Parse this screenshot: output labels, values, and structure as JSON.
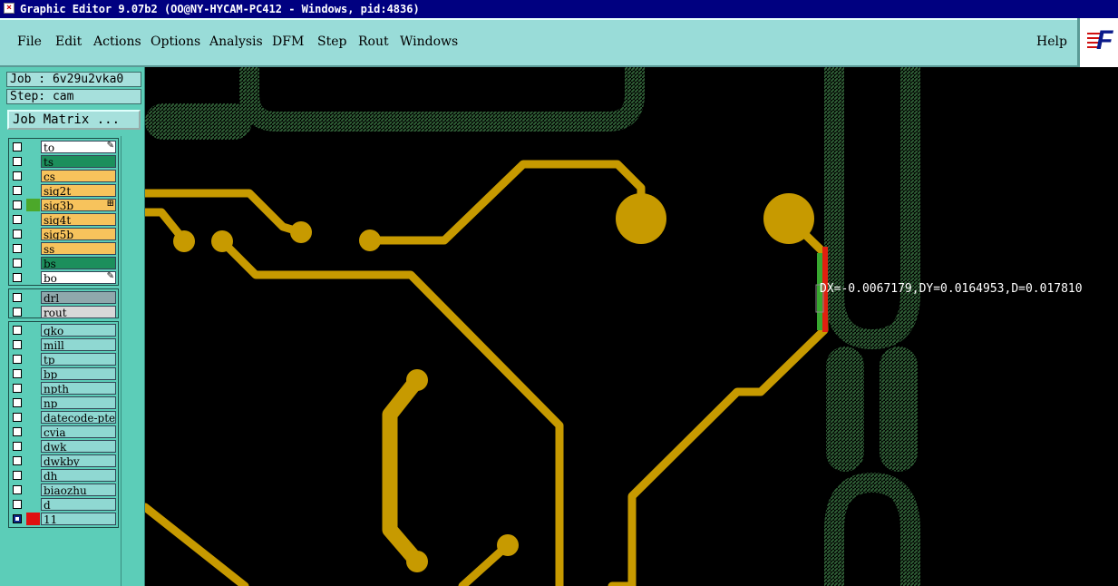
{
  "window": {
    "title": "Graphic Editor 9.07b2 (OO@NY-HYCAM-PC412 - Windows, pid:4836)"
  },
  "menubar": {
    "items": [
      "File",
      "Edit",
      "Actions",
      "Options",
      "Analysis",
      "DFM",
      "Step",
      "Rout",
      "Windows"
    ],
    "help": "Help"
  },
  "logo": {
    "text": "F",
    "icon": "frontline-logo-icon"
  },
  "job": {
    "job_label": "Job : 6v29u2vka0",
    "step_label": "Step: cam",
    "matrix_button": "Job Matrix ..."
  },
  "layers": {
    "board": [
      {
        "name": "to",
        "bg": "#ffffff",
        "cb": "empty",
        "mark": "✎"
      },
      {
        "name": "ts",
        "bg": "#1c8f5c",
        "cb": "empty"
      },
      {
        "name": "cs",
        "bg": "#f7c35c",
        "cb": "empty"
      },
      {
        "name": "sig2t",
        "bg": "#f7c35c",
        "cb": "empty"
      },
      {
        "name": "sig3b",
        "bg": "#f7c35c",
        "cb": "empty",
        "swatch": "#4ca82a",
        "mark": "⊞"
      },
      {
        "name": "sig4t",
        "bg": "#f7c35c",
        "cb": "empty"
      },
      {
        "name": "sig5b",
        "bg": "#f7c35c",
        "cb": "empty"
      },
      {
        "name": "ss",
        "bg": "#f7c35c",
        "cb": "empty"
      },
      {
        "name": "bs",
        "bg": "#1c8f5c",
        "cb": "empty"
      },
      {
        "name": "bo",
        "bg": "#ffffff",
        "cb": "empty",
        "mark": "✎"
      }
    ],
    "drill": [
      {
        "name": "drl",
        "bg": "#8fa8ac",
        "cb": "empty"
      },
      {
        "name": "rout",
        "bg": "#d8d8d8",
        "cb": "empty"
      }
    ],
    "misc": [
      {
        "name": "gko",
        "bg": "#8fd8d2",
        "cb": "empty"
      },
      {
        "name": "mill",
        "bg": "#8fd8d2",
        "cb": "empty"
      },
      {
        "name": "tp",
        "bg": "#8fd8d2",
        "cb": "empty"
      },
      {
        "name": "bp",
        "bg": "#8fd8d2",
        "cb": "empty"
      },
      {
        "name": "npth",
        "bg": "#8fd8d2",
        "cb": "empty"
      },
      {
        "name": "np",
        "bg": "#8fd8d2",
        "cb": "empty"
      },
      {
        "name": "datecode-pte",
        "bg": "#8fd8d2",
        "cb": "empty"
      },
      {
        "name": "cvia",
        "bg": "#8fd8d2",
        "cb": "empty"
      },
      {
        "name": "dwk",
        "bg": "#8fd8d2",
        "cb": "empty"
      },
      {
        "name": "dwkby",
        "bg": "#8fd8d2",
        "cb": "empty"
      },
      {
        "name": "dh",
        "bg": "#8fd8d2",
        "cb": "empty"
      },
      {
        "name": "biaozhu",
        "bg": "#8fd8d2",
        "cb": "empty"
      },
      {
        "name": "d",
        "bg": "#8fd8d2",
        "cb": "empty"
      },
      {
        "name": "11",
        "bg": "#8fd8d2",
        "cb": "sel",
        "swatch": "#e01010"
      }
    ]
  },
  "canvas": {
    "measure_text": "DX=-0.0067179,DY=0.0164953,D=0.017810",
    "colors": {
      "trace": "#c79a00",
      "hatch": "#2f5e36",
      "highlight_red": "#e02010",
      "highlight_green": "#38a830"
    }
  }
}
